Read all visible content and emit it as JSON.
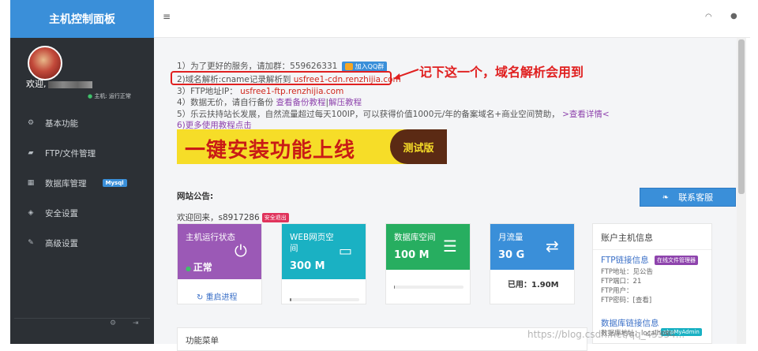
{
  "sidebar": {
    "title": "主机控制面板",
    "welcome": "欢迎,",
    "host_status": "主机: 运行正常",
    "items": [
      {
        "label": "基本功能",
        "icon": "gears-icon"
      },
      {
        "label": "FTP/文件管理",
        "icon": "folder-icon"
      },
      {
        "label": "数据库管理",
        "icon": "table-icon",
        "badge": "Mysql"
      },
      {
        "label": "安全设置",
        "icon": "shield-icon"
      },
      {
        "label": "高级设置",
        "icon": "edit-icon"
      }
    ]
  },
  "notices": {
    "line1": "1）为了更好的服务，请加群：559626331",
    "qq_button": "加入QQ群",
    "line2_prefix": "2)域名解析:cname记录解析到",
    "line2_value": "usfree1-cdn.renzhijia.com",
    "line3_prefix": "3）FTP地址IP：",
    "line3_value": "usfree1-ftp.renzhijia.com",
    "line4_prefix": "4）数据无价，请自行备份",
    "line4_link1": "查看备份教程",
    "line4_sep": "|",
    "line4_link2": "解压教程",
    "line5_prefix": "5）乐云扶持站长发展，自然流量超过每天100IP，可以获得价值1000元/年的备案域名+商业空间赞助，",
    "line5_link": ">查看详情<",
    "line6": "6)更多使用教程点击"
  },
  "annotation": "记下这一个，域名解析会用到",
  "banner": {
    "text": "一键安装功能上线",
    "tag": "测试版"
  },
  "site_notice_title": "网站公告:",
  "support_button": "联系客服",
  "welcome_back": "欢迎回来，s8917286",
  "logout_button": "安全退出",
  "cards": [
    {
      "title": "主机运行状态",
      "value": "正常",
      "action": "重启进程",
      "color": "#9b59b6"
    },
    {
      "title": "WEB网页空间",
      "value": "300 M",
      "usage": 0.02,
      "color": "#1ab1c3"
    },
    {
      "title": "数据库空间",
      "value": "100 M",
      "usage": 0.01,
      "color": "#27ae60"
    },
    {
      "title": "月流量",
      "value": "30 G",
      "used": "已用：1.90M",
      "color": "#3a8fd9"
    }
  ],
  "account": {
    "title": "账户主机信息",
    "ftp_link": "FTP链接信息",
    "ftp_badge": "在线文件管理器",
    "ftp_lines": [
      "FTP地址：见公告",
      "FTP端口：21",
      "FTP用户：",
      "FTP密码：[查看]"
    ],
    "db_link": "数据库链接信息",
    "db_badge": "phpMyAdmin",
    "db_line": "数据库地址：localhost"
  },
  "function_menu": "功能菜单",
  "watermark": "https://blog.csdn.net/qq_45334... "
}
